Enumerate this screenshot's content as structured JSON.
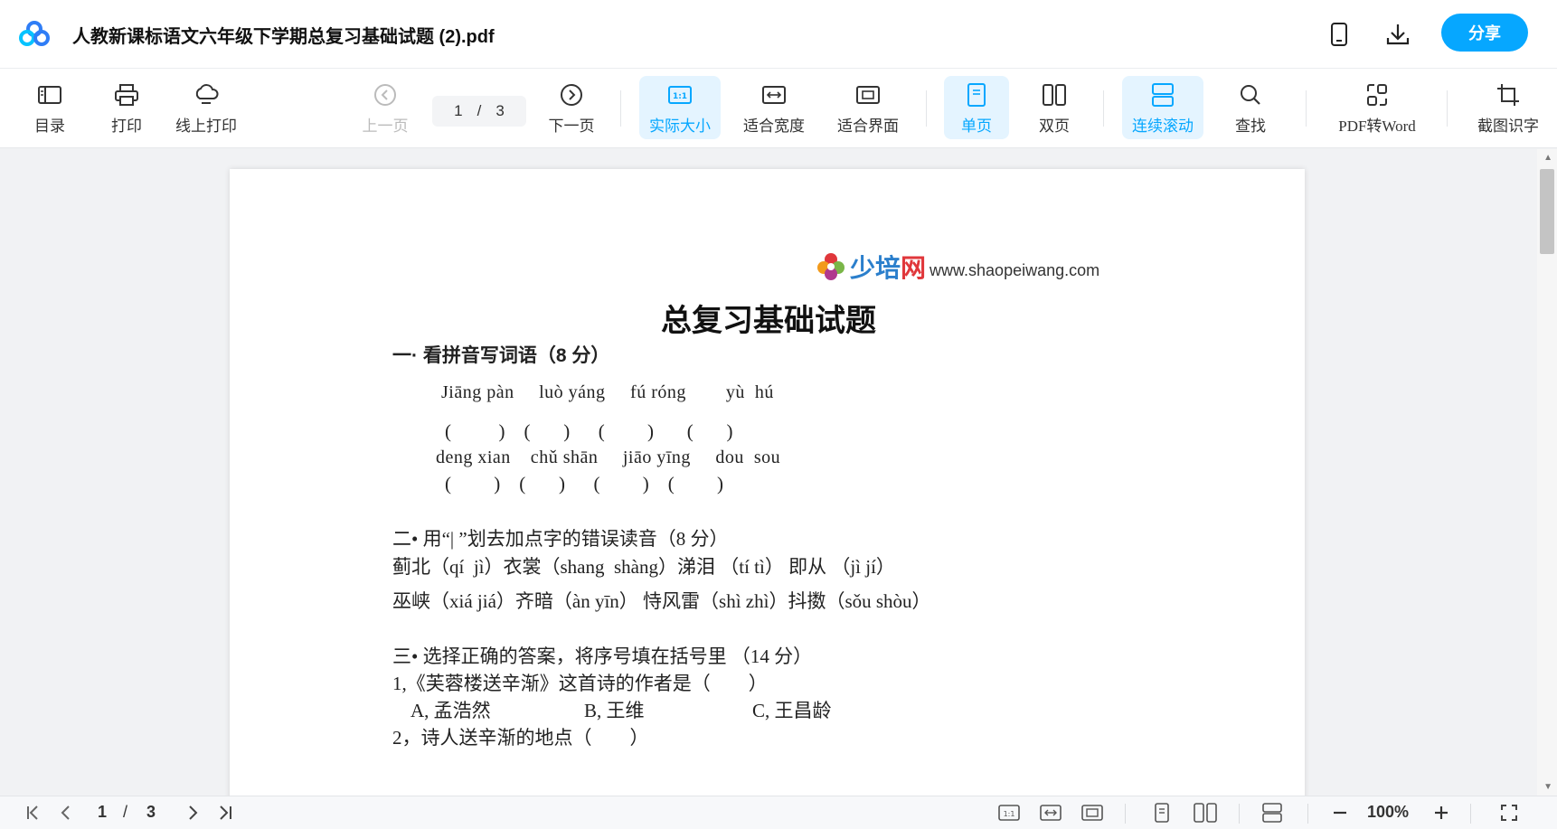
{
  "header": {
    "title": "人教新课标语文六年级下学期总复习基础试题 (2).pdf",
    "share_label": "分享"
  },
  "toolbar": {
    "toc": "目录",
    "print": "打印",
    "online_print": "线上打印",
    "prev_page": "上一页",
    "current_page": "1",
    "page_sep": "/",
    "total_pages": "3",
    "next_page": "下一页",
    "actual_size": "实际大小",
    "fit_width": "适合宽度",
    "fit_screen": "适合界面",
    "single_page": "单页",
    "double_page": "双页",
    "continuous_scroll": "连续滚动",
    "find": "查找",
    "pdf_to_word": "PDF转Word",
    "ocr": "截图识字"
  },
  "document": {
    "site_brand_a": "少培",
    "site_brand_b": "网",
    "site_url": "www.shaopeiwang.com",
    "title": "总复习基础试题",
    "s1_heading": "一· 看拼音写词语（8 分）",
    "s1_pinyin_1": "Jiāng pàn     luò yáng     fú róng        yù  hú",
    "s1_paren_1": "(          )    (       )      (         )       (       )",
    "s1_pinyin_2": "deng xian    chǔ shān     jiāo yīng     dou  sou",
    "s1_paren_2": "(         )    (       )      (         )    (         )",
    "s2_heading": "二• 用“| ”划去加点字的错误读音（8 分）",
    "s2_line_1": "蓟北（qí  jì）衣裳（shang  shàng）涕泪 （tí tì） 即从 （jì jí）",
    "s2_line_2": "巫峡（xiá jiá）齐暗（àn yīn） 恃风雷（shì zhì）抖擞（sǒu shòu）",
    "s3_heading": "三• 选择正确的答案，将序号填在括号里 （14 分）",
    "s3_q1": "1,《芙蓉楼送辛渐》这首诗的作者是（        ）",
    "s3_q1_a": "A, 孟浩然",
    "s3_q1_b": "B, 王维",
    "s3_q1_c": "C, 王昌龄",
    "s3_q2": "2，诗人送辛渐的地点（        ）"
  },
  "bottombar": {
    "current_page": "1",
    "page_sep": "/",
    "total_pages": "3",
    "zoom": "100%"
  },
  "colors": {
    "accent": "#06a7ff",
    "active_bg": "#e4f4ff"
  }
}
